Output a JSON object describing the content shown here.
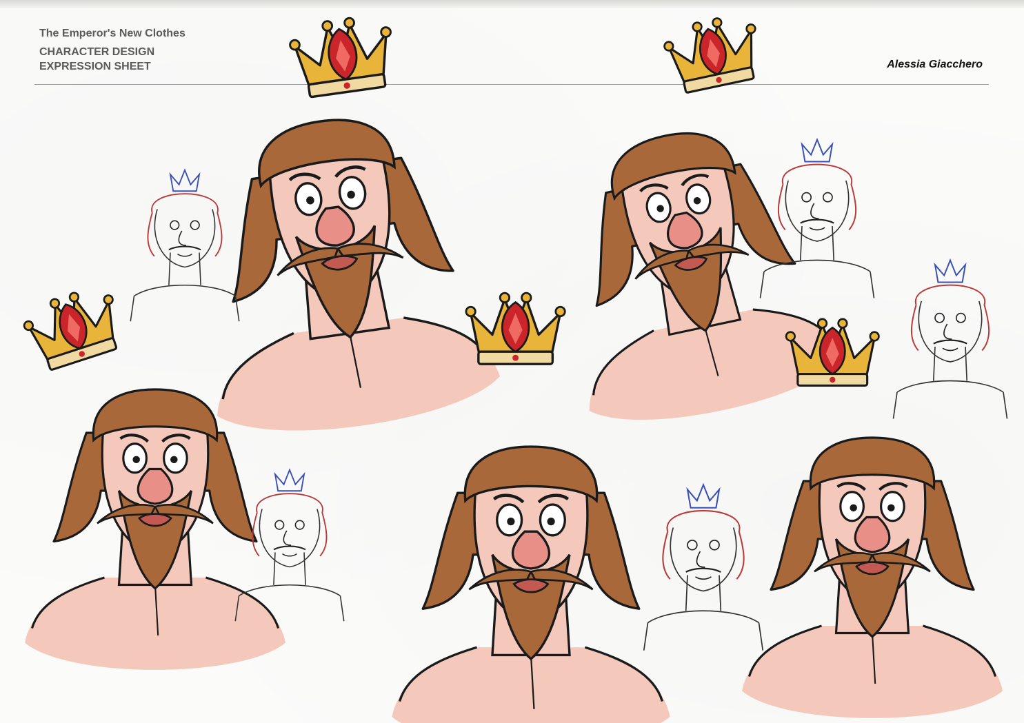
{
  "header": {
    "project_title": "The Emperor's New Clothes",
    "sheet_line_1": "CHARACTER DESIGN",
    "sheet_line_2": "EXPRESSION SHEET",
    "author": "Alessia Giacchero"
  },
  "colors": {
    "paper": "#fbfbfa",
    "skin": "#f4c9bc",
    "nose": "#e88f88",
    "hair": "#a8683a",
    "hair_dark": "#7a4a28",
    "crown_gold": "#e9b43a",
    "crown_gem": "#c9252a",
    "sketch_red": "#b83a3a",
    "sketch_blue": "#3a4fb8",
    "ink": "#1a1a1a"
  }
}
